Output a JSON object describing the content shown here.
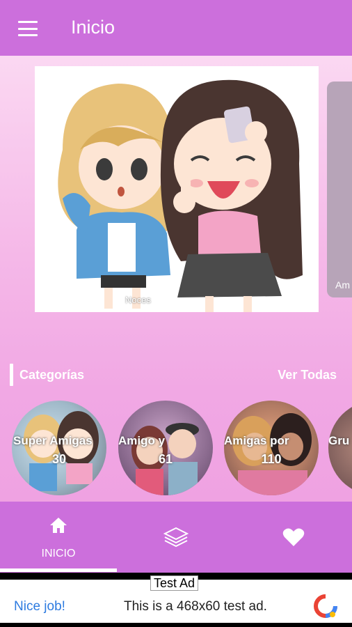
{
  "appbar": {
    "title": "Inicio"
  },
  "slider": {
    "caption": "Noces",
    "next_label": "Am"
  },
  "categories": {
    "title": "Categorías",
    "see_all": "Ver Todas",
    "items": [
      {
        "name": "Super Amigas",
        "count": "30"
      },
      {
        "name": "Amigo y",
        "count": "61"
      },
      {
        "name": "Amigas por",
        "count": "110"
      },
      {
        "name": "Gru",
        "count": ""
      }
    ]
  },
  "bottom_nav": {
    "items": [
      {
        "label": "INICIO",
        "icon": "home-icon"
      },
      {
        "label": "",
        "icon": "layers-icon"
      },
      {
        "label": "",
        "icon": "heart-icon"
      }
    ]
  },
  "ad": {
    "tag": "Test Ad",
    "left": "Nice job!",
    "text": "This is a 468x60 test ad."
  },
  "colors": {
    "accent": "#cc6fdc",
    "background_top": "#fbd8f2",
    "background_bottom": "#efa2e2"
  }
}
